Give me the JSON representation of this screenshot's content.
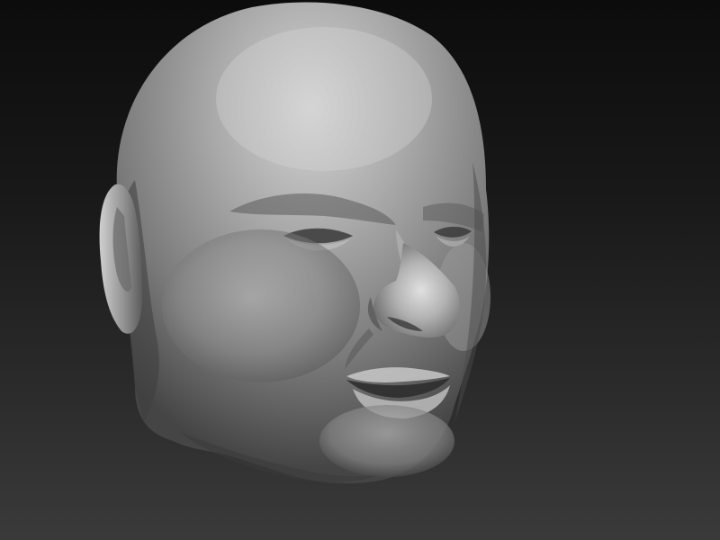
{
  "viewport": {
    "background_top": "#0c0c0c",
    "background_bottom": "#3a3a3a"
  },
  "model": {
    "subject": "sculpted-head-mesh",
    "material_base": "#8a8a8a",
    "material_highlight": "#d2d2d2",
    "material_shadow": "#2e2e2e"
  }
}
